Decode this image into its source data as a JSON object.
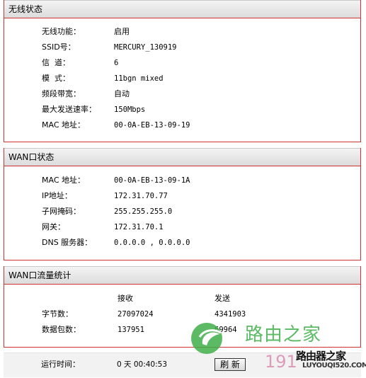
{
  "wireless": {
    "title": "无线状态",
    "rows": [
      {
        "label": "无线功能：",
        "value": "启用"
      },
      {
        "label": "SSID号：",
        "value": "MERCURY_130919"
      },
      {
        "label": "信  道：",
        "value": "6"
      },
      {
        "label": "模  式：",
        "value": "11bgn mixed"
      },
      {
        "label": "频段带宽：",
        "value": "自动"
      },
      {
        "label": "最大发送速率：",
        "value": "150Mbps"
      },
      {
        "label": "MAC 地址：",
        "value": "00-0A-EB-13-09-19"
      }
    ]
  },
  "wan": {
    "title": "WAN口状态",
    "rows": [
      {
        "label": "MAC 地址：",
        "value": "00-0A-EB-13-09-1A"
      },
      {
        "label": "IP地址：",
        "value": "172.31.70.77"
      },
      {
        "label": "子网掩码：",
        "value": "255.255.255.0"
      },
      {
        "label": "网关：",
        "value": "172.31.70.1"
      },
      {
        "label": "DNS 服务器：",
        "value": "0.0.0.0 , 0.0.0.0"
      }
    ]
  },
  "traffic": {
    "title": "WAN口流量统计",
    "col_recv": "接收",
    "col_send": "发送",
    "rows": [
      {
        "label": "字节数：",
        "recv": "27097024",
        "send": "4341903"
      },
      {
        "label": "数据包数：",
        "recv": "137951",
        "send": "69964"
      }
    ]
  },
  "uptime": {
    "label": "运行时间：",
    "value": "0 天 00:40:53",
    "refresh_label": "刷 新"
  },
  "watermark": {
    "brand_cn": "路由之家",
    "brand2_cn": "路由器之家",
    "num": "191",
    "site": "LUYOUQI520.COM"
  }
}
